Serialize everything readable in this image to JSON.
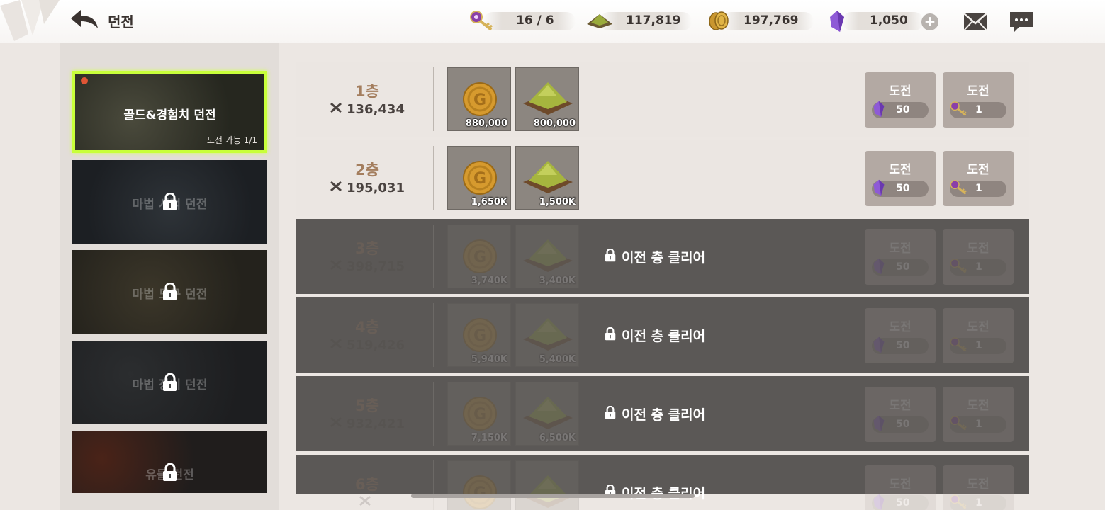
{
  "header": {
    "title": "던전"
  },
  "resources": [
    {
      "icon": "dungeon-key-icon",
      "value": "16 / 6"
    },
    {
      "icon": "exp-powder-icon",
      "value": "117,819"
    },
    {
      "icon": "gold-coin-icon",
      "value": "197,769"
    },
    {
      "icon": "purple-crystal-icon",
      "value": "1,050"
    }
  ],
  "plus_label": "+",
  "dungeons": [
    {
      "name": "골드&경험치 던전",
      "status": "도전 가능 1/1",
      "locked": false
    },
    {
      "name": "마법 서적 던전",
      "locked": true
    },
    {
      "name": "마법 도구 던전",
      "locked": true
    },
    {
      "name": "마법 장비 던전",
      "locked": true
    },
    {
      "name": "유물 던전",
      "locked": true
    }
  ],
  "floors": [
    {
      "name": "1층",
      "power": "136,434",
      "gold": "880,000",
      "exp": "800,000",
      "locked": false
    },
    {
      "name": "2층",
      "power": "195,031",
      "gold": "1,650K",
      "exp": "1,500K",
      "locked": false
    },
    {
      "name": "3층",
      "power": "398,715",
      "gold": "3,740K",
      "exp": "3,400K",
      "locked": true
    },
    {
      "name": "4층",
      "power": "519,426",
      "gold": "5,940K",
      "exp": "5,400K",
      "locked": true
    },
    {
      "name": "5층",
      "power": "932,421",
      "gold": "7,150K",
      "exp": "6,500K",
      "locked": true
    },
    {
      "name": "6층",
      "power": "",
      "gold": "",
      "exp": "",
      "locked": true
    }
  ],
  "challenge": {
    "label": "도전",
    "crystal_cost": "50",
    "key_cost": "1"
  },
  "locked_message": "이전 층 클리어",
  "colors": {
    "highlight": "#c8ff3a",
    "floor_name": "#a47e5e",
    "locked_row": "#5b5856"
  }
}
